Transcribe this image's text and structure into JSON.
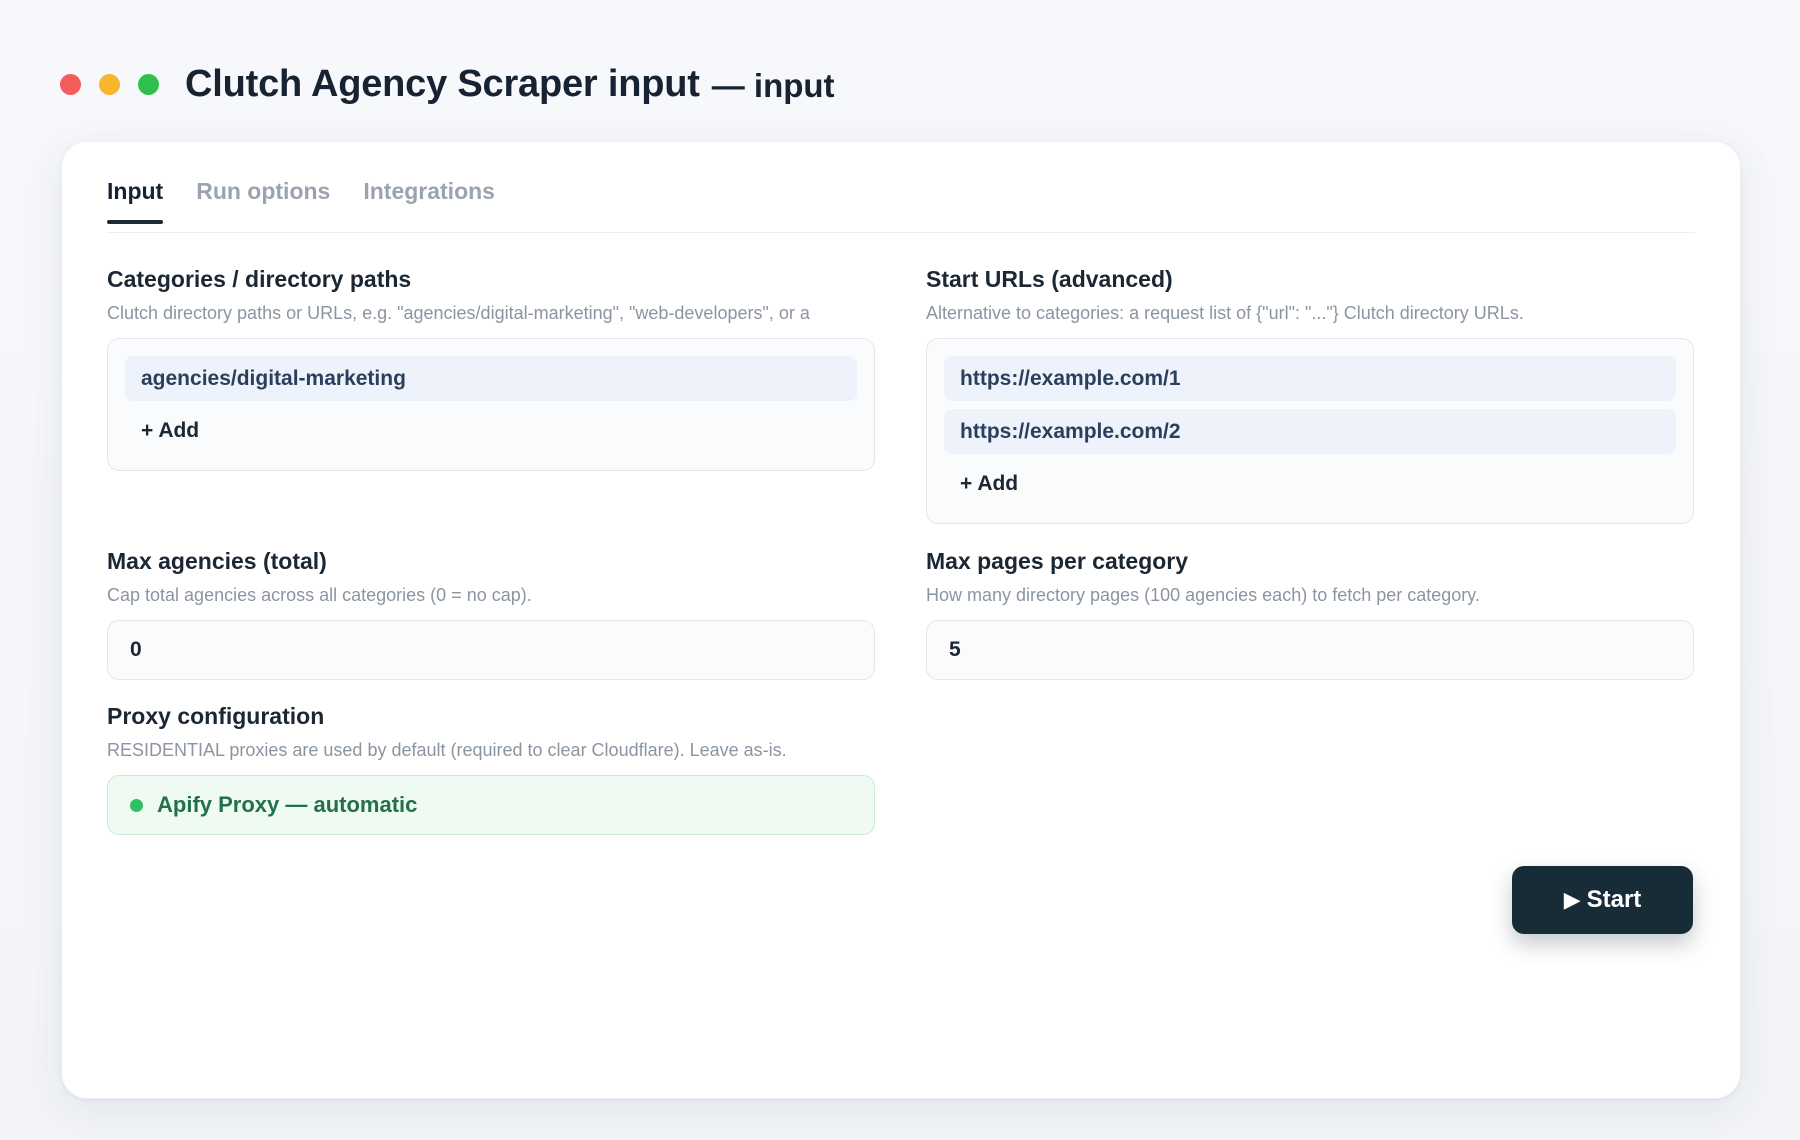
{
  "window": {
    "title": "Clutch Agency Scraper input",
    "title_suffix": "— input",
    "traffic_lights": [
      "#f45b5b",
      "#f9b52b",
      "#2ec04a"
    ]
  },
  "tabs": [
    {
      "label": "Input",
      "active": true
    },
    {
      "label": "Run options",
      "active": false
    },
    {
      "label": "Integrations",
      "active": false
    }
  ],
  "fields": {
    "categories": {
      "label": "Categories / directory paths",
      "description": "Clutch directory paths or URLs, e.g. \"agencies/digital-marketing\", \"web-developers\", or a",
      "items": [
        "agencies/digital-marketing"
      ],
      "add_label": "+ Add"
    },
    "start_urls": {
      "label": "Start URLs (advanced)",
      "description": "Alternative to categories: a request list of {\"url\": \"...\"} Clutch directory URLs.",
      "items": [
        "https://example.com/1",
        "https://example.com/2"
      ],
      "add_label": "+ Add"
    },
    "max_agencies": {
      "label": "Max agencies (total)",
      "description": "Cap total agencies across all categories (0 = no cap).",
      "value": "0"
    },
    "max_pages": {
      "label": "Max pages per category",
      "description": "How many directory pages (100 agencies each) to fetch per category.",
      "value": "5"
    },
    "proxy": {
      "label": "Proxy configuration",
      "description": "RESIDENTIAL proxies are used by default (required to clear Cloudflare). Leave as-is.",
      "value": "Apify Proxy — automatic",
      "status_color": "#2fbf64"
    }
  },
  "actions": {
    "start_icon": "▶",
    "start_label": "Start"
  }
}
